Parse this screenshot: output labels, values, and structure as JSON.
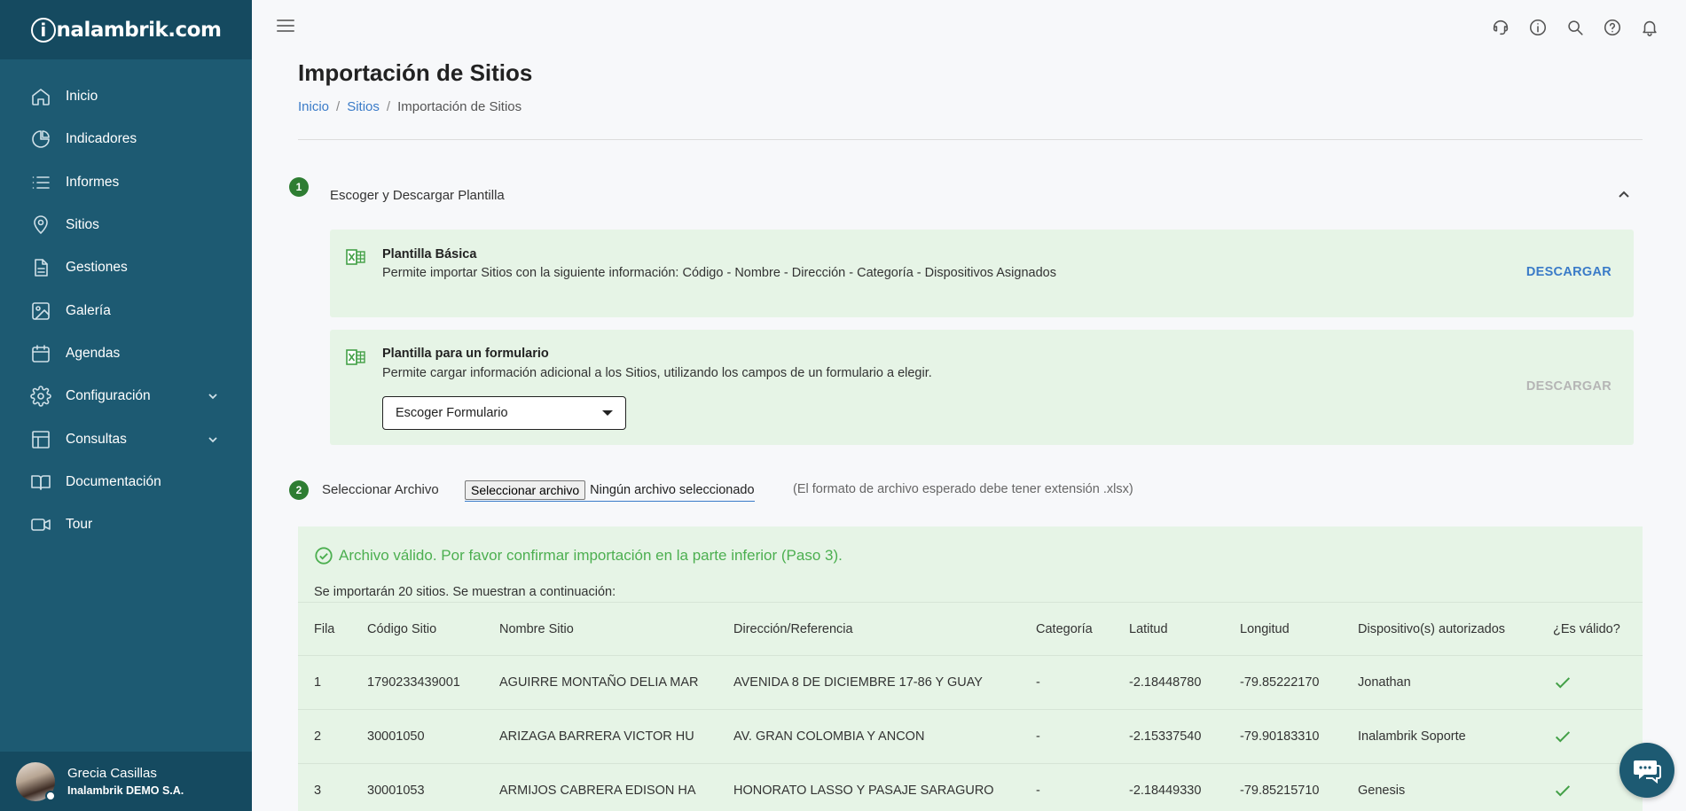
{
  "brand": {
    "logo_text": "nalambrik.com",
    "logo_mark": "i"
  },
  "sidebar": {
    "items": [
      {
        "label": "Inicio",
        "icon": "home-icon"
      },
      {
        "label": "Indicadores",
        "icon": "pie-chart-icon"
      },
      {
        "label": "Informes",
        "icon": "list-icon"
      },
      {
        "label": "Sitios",
        "icon": "location-pin-icon"
      },
      {
        "label": "Gestiones",
        "icon": "document-icon"
      },
      {
        "label": "Galería",
        "icon": "image-icon"
      },
      {
        "label": "Agendas",
        "icon": "calendar-icon"
      },
      {
        "label": "Configuración",
        "icon": "gear-icon",
        "expandable": true
      },
      {
        "label": "Consultas",
        "icon": "table-icon",
        "expandable": true
      },
      {
        "label": "Documentación",
        "icon": "book-icon"
      },
      {
        "label": "Tour",
        "icon": "video-icon"
      }
    ]
  },
  "user": {
    "name": "Grecia Casillas",
    "company": "Inalambrik DEMO S.A."
  },
  "topbar": {
    "icons": [
      "support-icon",
      "info-icon",
      "search-icon",
      "help-icon",
      "bell-icon"
    ]
  },
  "page": {
    "title": "Importación de Sitios",
    "breadcrumb": [
      "Inicio",
      "Sitios",
      "Importación de Sitios"
    ],
    "breadcrumb_sep": "/"
  },
  "step1": {
    "number": "1",
    "label": "Escoger y Descargar Plantilla",
    "basic": {
      "title": "Plantilla Básica",
      "desc": "Permite importar Sitios con la siguiente información: Código - Nombre - Dirección - Categoría - Dispositivos Asignados",
      "button": "DESCARGAR"
    },
    "form": {
      "title": "Plantilla para un formulario",
      "desc": "Permite cargar información adicional a los Sitios, utilizando los campos de un formulario a elegir.",
      "select_value": "Escoger Formulario",
      "button": "DESCARGAR"
    }
  },
  "step2": {
    "number": "2",
    "label": "Seleccionar Archivo",
    "file_button": "Seleccionar archivo",
    "file_name": "Ningún archivo seleccionado",
    "hint": "(El formato de archivo esperado debe tener extensión .xlsx)"
  },
  "result": {
    "message": "Archivo válido. Por favor confirmar importación en la parte inferior (Paso 3).",
    "note": "Se importarán 20 sitios. Se muestran a continuación:",
    "columns": [
      "Fila",
      "Código Sitio",
      "Nombre Sitio",
      "Dirección/Referencia",
      "Categoría",
      "Latitud",
      "Longitud",
      "Dispositivo(s) autorizados",
      "¿Es válido?"
    ],
    "rows": [
      {
        "fila": "1",
        "codigo": "1790233439001",
        "nombre": "AGUIRRE MONTAÑO DELIA MAR",
        "direccion": "AVENIDA 8 DE DICIEMBRE 17-86 Y GUAY",
        "categoria": "-",
        "latitud": "-2.18448780",
        "longitud": "-79.85222170",
        "dispositivos": "Jonathan",
        "valido": true
      },
      {
        "fila": "2",
        "codigo": "30001050",
        "nombre": "ARIZAGA BARRERA VICTOR HU",
        "direccion": "AV. GRAN COLOMBIA Y ANCON",
        "categoria": "-",
        "latitud": "-2.15337540",
        "longitud": "-79.90183310",
        "dispositivos": "Inalambrik Soporte",
        "valido": true
      },
      {
        "fila": "3",
        "codigo": "30001053",
        "nombre": "ARMIJOS CABRERA EDISON HA",
        "direccion": "HONORATO LASSO Y PASAJE SARAGURO",
        "categoria": "-",
        "latitud": "-2.18449330",
        "longitud": "-79.85215710",
        "dispositivos": "Genesis",
        "valido": true
      }
    ]
  },
  "colors": {
    "sidebar": "#1d5a72",
    "sidebar_header": "#154a60",
    "accent": "#3a7bc8",
    "success": "#4caf50",
    "card_bg": "#e6f4e6",
    "step_badge": "#2e7d32"
  }
}
